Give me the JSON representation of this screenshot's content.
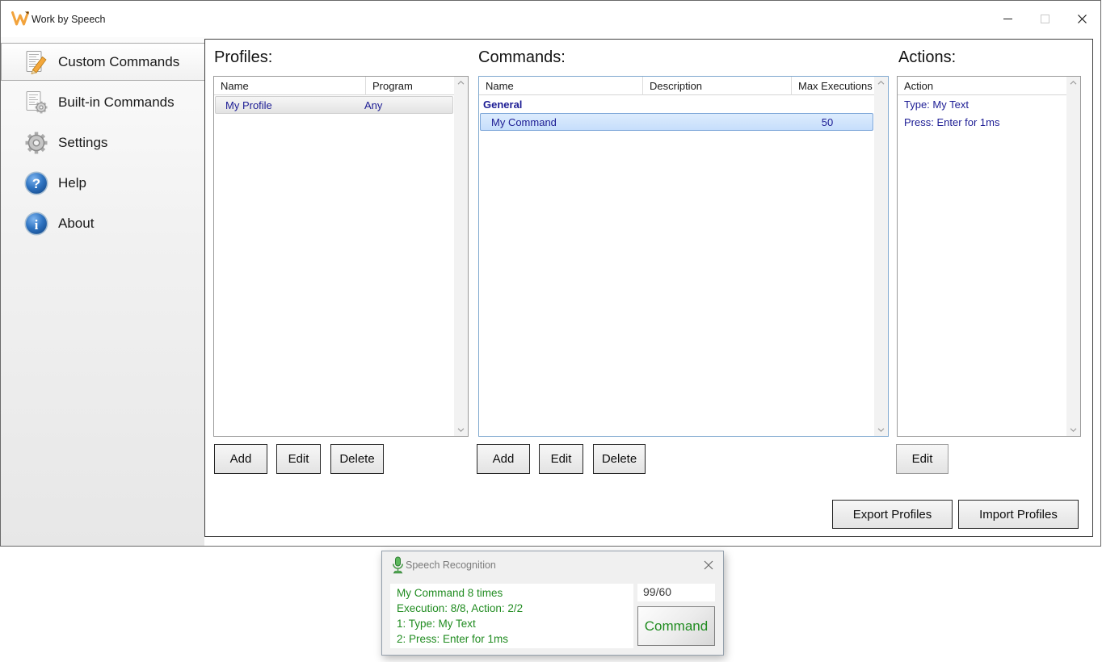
{
  "window": {
    "title": "Work by Speech"
  },
  "sidebar": {
    "items": [
      {
        "label": "Custom Commands",
        "icon": "document-pencil-icon",
        "selected": true
      },
      {
        "label": "Built-in Commands",
        "icon": "document-gear-icon",
        "selected": false
      },
      {
        "label": "Settings",
        "icon": "gear-icon",
        "selected": false
      },
      {
        "label": "Help",
        "icon": "help-icon",
        "selected": false
      },
      {
        "label": "About",
        "icon": "info-icon",
        "selected": false
      }
    ]
  },
  "profiles": {
    "heading": "Profiles:",
    "columns": [
      "Name",
      "Program"
    ],
    "rows": [
      {
        "name": "My Profile",
        "program": "Any",
        "selected": true
      }
    ],
    "buttons": [
      "Add",
      "Edit",
      "Delete"
    ]
  },
  "commands": {
    "heading": "Commands:",
    "columns": [
      "Name",
      "Description",
      "Max Executions"
    ],
    "group": "General",
    "rows": [
      {
        "name": "My Command",
        "description": "",
        "max_executions": "50",
        "selected": true
      }
    ],
    "buttons": [
      "Add",
      "Edit",
      "Delete"
    ]
  },
  "actions": {
    "heading": "Actions:",
    "columns": [
      "Action"
    ],
    "rows": [
      "Type: My Text",
      "Press: Enter for 1ms"
    ],
    "edit_label": "Edit"
  },
  "footer": {
    "export_label": "Export Profiles",
    "import_label": "Import Profiles"
  },
  "speech_window": {
    "title": "Speech Recognition",
    "lines": [
      "My Command 8 times",
      "Execution: 8/8, Action: 2/2",
      "1: Type: My Text",
      "2: Press: Enter for 1ms"
    ],
    "counter": "99/60",
    "button_label": "Command"
  },
  "colors": {
    "row_text": "#1c1c94",
    "green": "#218c21",
    "sel_border": "#7da6d8",
    "accent_orange": "#f2a33c"
  }
}
